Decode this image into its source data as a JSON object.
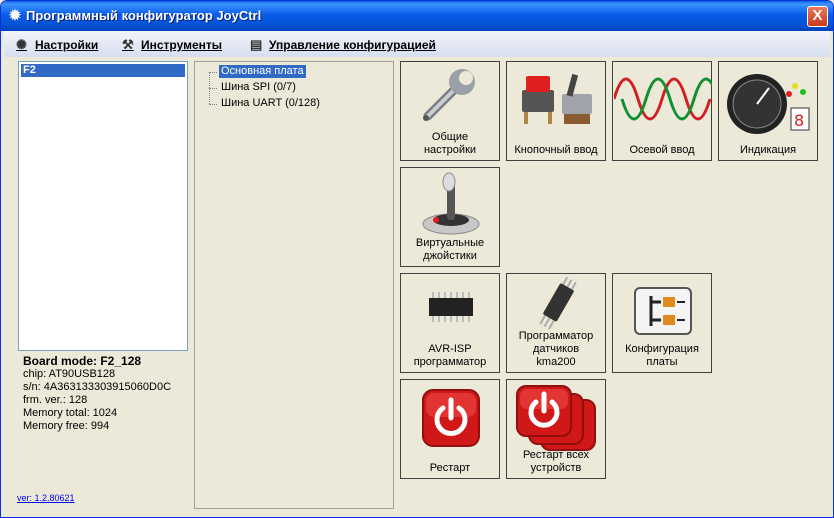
{
  "window": {
    "title": "Программный конфигуратор JoyCtrl",
    "close_label": "X"
  },
  "menu": [
    {
      "label": "Настройки",
      "icon": "gear-icon"
    },
    {
      "label": "Инструменты",
      "icon": "wrench-icon"
    },
    {
      "label": "Управление конфигурацией",
      "icon": "config-icon"
    }
  ],
  "device_list": {
    "selected": "F2"
  },
  "board_info": {
    "mode": "Board mode: F2_128",
    "chip": "chip: AT90USB128",
    "sn": "s/n: 4A363133303915060D0C",
    "frm": "frm. ver.: 128",
    "mem_total": "Memory total: 1024",
    "mem_free": "Memory free: 994"
  },
  "version": "ver: 1.2.80621",
  "tree": {
    "nodes": [
      "Основная плата",
      "Шина SPI (0/7)",
      "Шина UART (0/128)"
    ]
  },
  "tiles": {
    "general": {
      "line1": "Общие",
      "line2": "настройки",
      "icon": "wrench-icon"
    },
    "buttons": {
      "line1": "Кнопочный ввод",
      "icon": "toggle-switch-icon"
    },
    "axis": {
      "line1": "Осевой ввод",
      "icon": "sine-wave-icon"
    },
    "indication": {
      "line1": "Индикация",
      "icon": "gauge-icon"
    },
    "virtual": {
      "line1": "Виртуальные",
      "line2": "джойстики",
      "icon": "joystick-icon"
    },
    "avr": {
      "line1": "AVR-ISP",
      "line2": "программатор",
      "icon": "chip-icon"
    },
    "sensor": {
      "line1": "Программатор",
      "line2": "датчиков",
      "line3": "kma200",
      "icon": "sensor-chip-icon"
    },
    "boardcfg": {
      "line1": "Конфигурация",
      "line2": "платы",
      "icon": "tree-config-icon"
    },
    "restart": {
      "line1": "Рестарт",
      "icon": "power-icon"
    },
    "restart_all": {
      "line1": "Рестарт всех",
      "line2": "устройств",
      "icon": "power-multi-icon"
    }
  }
}
